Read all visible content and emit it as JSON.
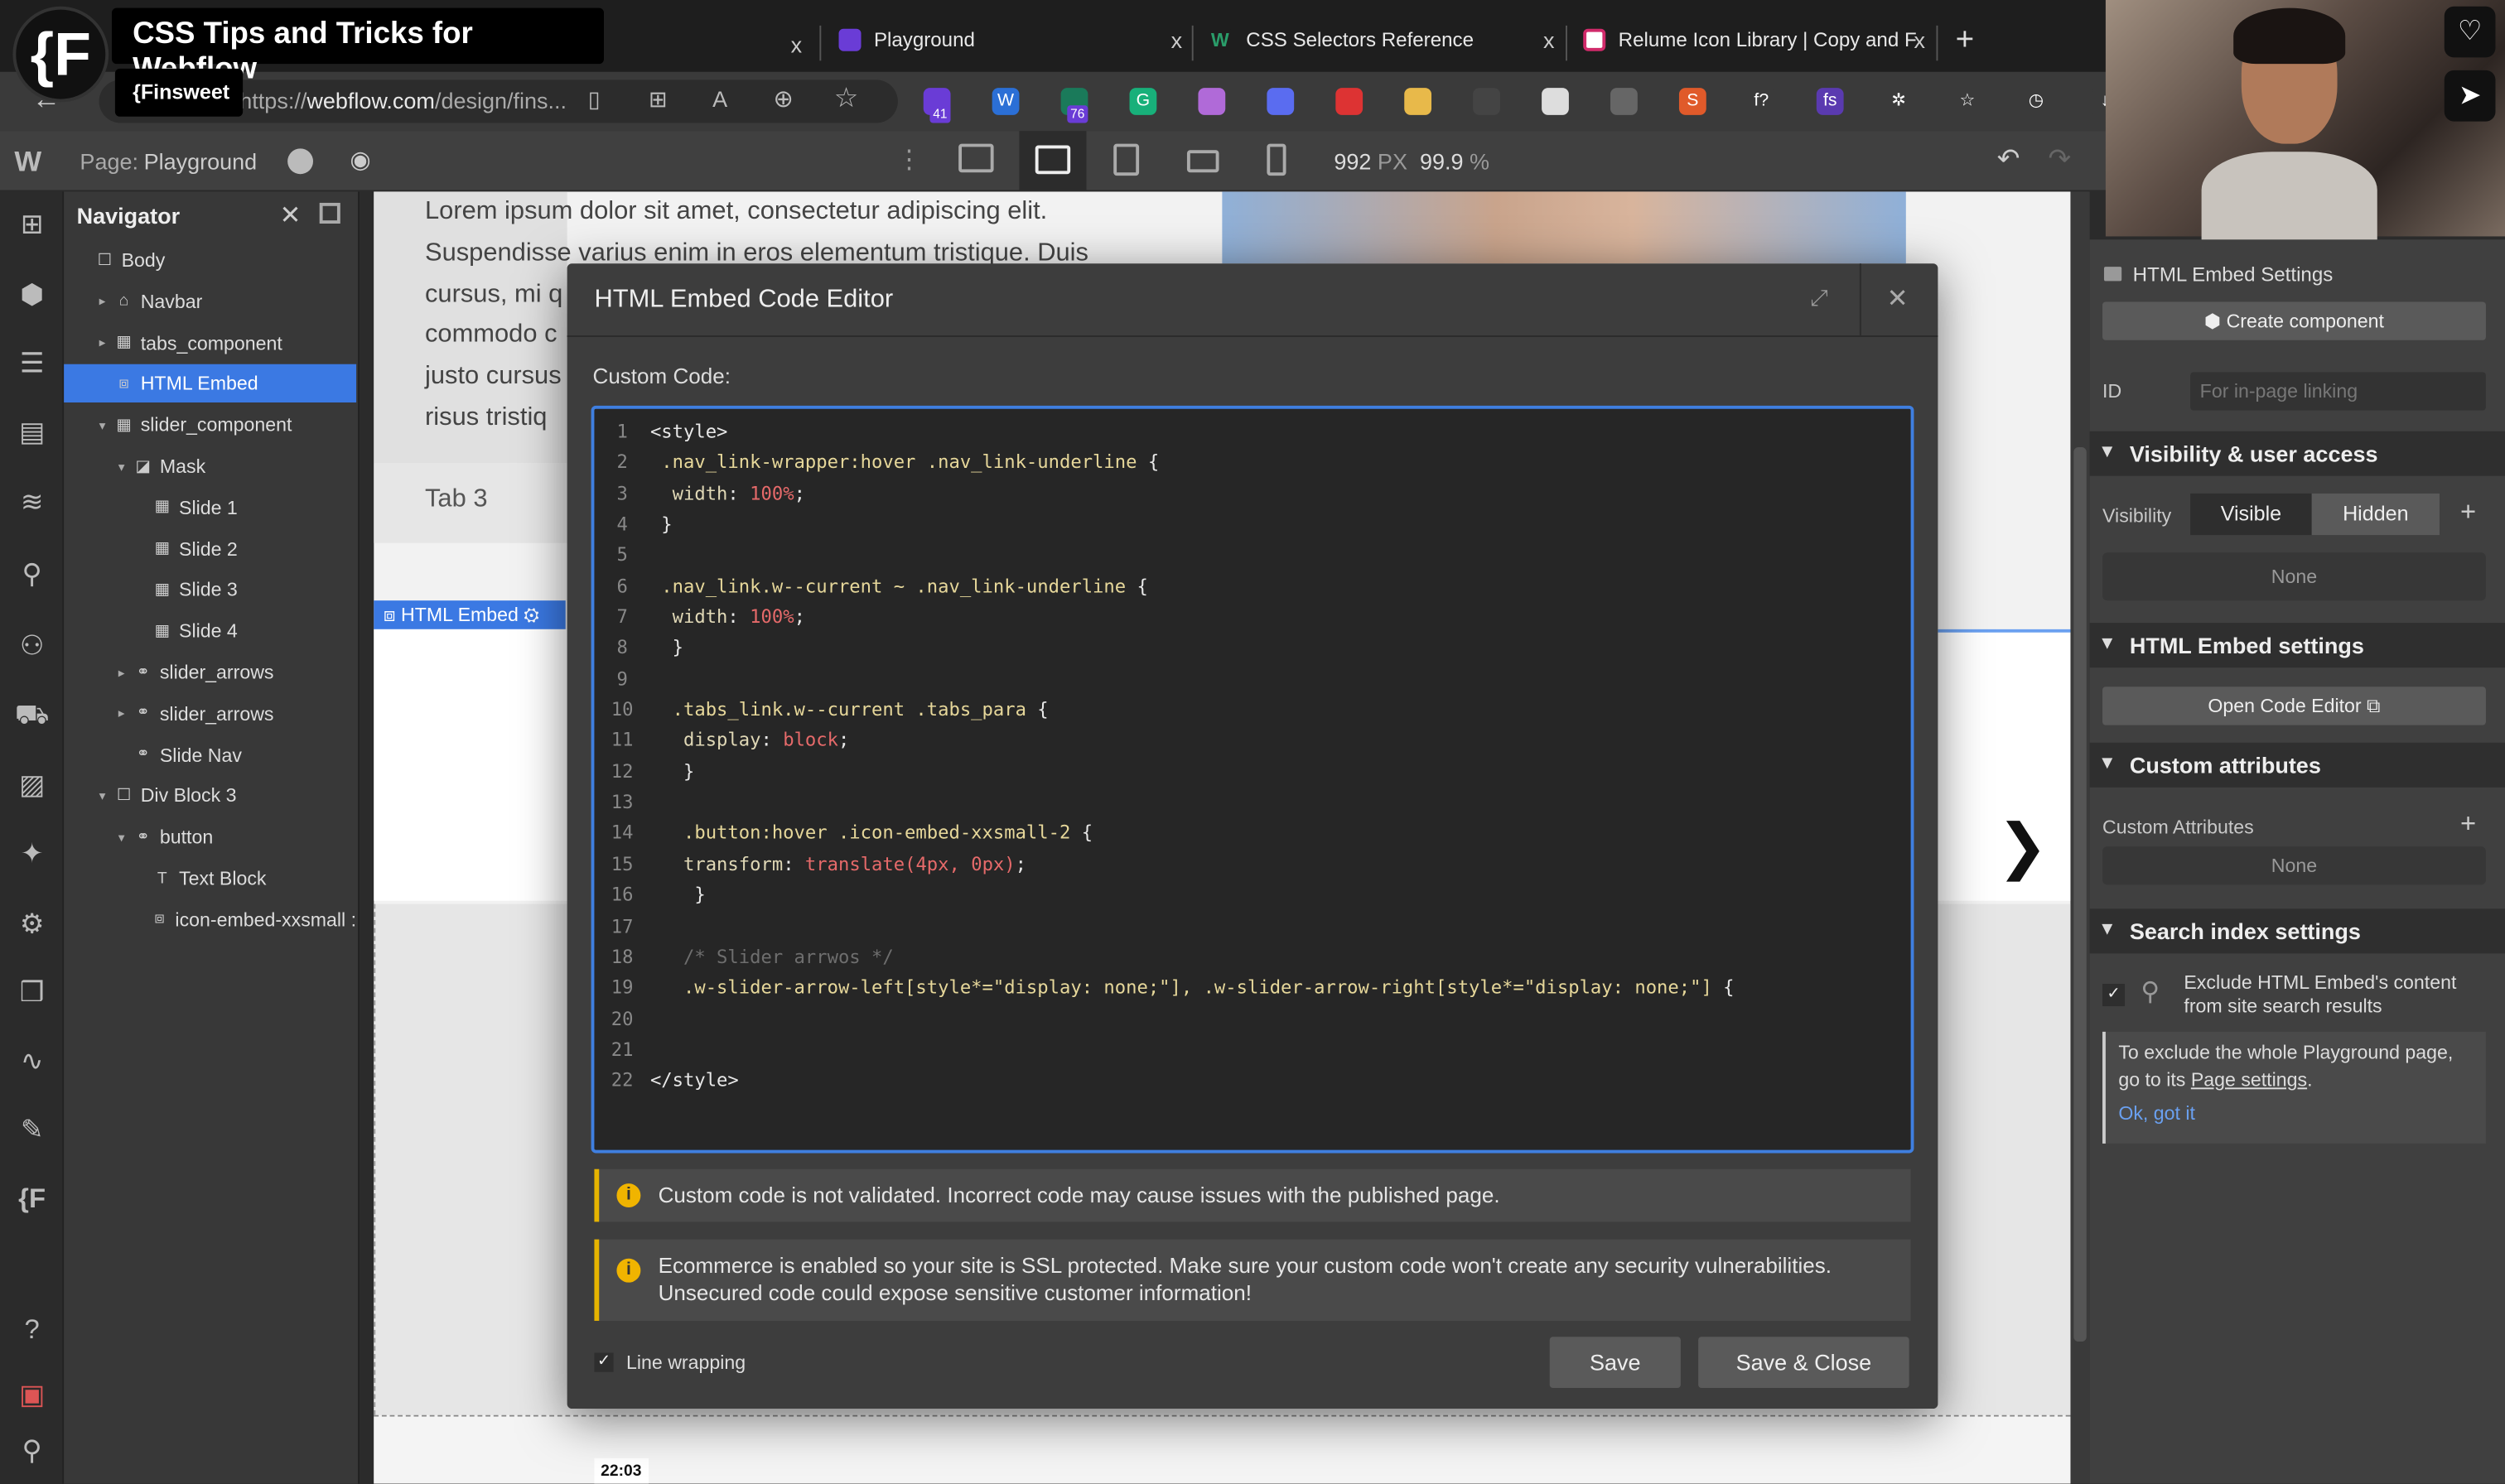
{
  "overlay": {
    "title": "CSS Tips and Tricks for Webflow",
    "subtitle": "{Finsweet",
    "logo_text": "{F"
  },
  "browser": {
    "tabs": [
      {
        "label": "Playground",
        "close": "x"
      },
      {
        "label": "CSS Selectors Reference",
        "close": "x"
      },
      {
        "label": "Relume Icon Library | Copy and F",
        "close": "x"
      }
    ],
    "first_tab_close": "x",
    "new_tab": "+",
    "url_prefix": "https://",
    "url_host": "webflow.com",
    "url_path": "/design/fins...",
    "extensions": [
      {
        "name": "ext-purple",
        "color": "#6a3cd6",
        "badge": "41"
      },
      {
        "name": "word",
        "color": "#2b6fd6",
        "text": "W"
      },
      {
        "name": "ext-green",
        "color": "#1a7a5a",
        "badge": "76"
      },
      {
        "name": "grammarly",
        "color": "#18b07a",
        "text": "G"
      },
      {
        "name": "ext-pink",
        "color": "#b06ad8"
      },
      {
        "name": "ext-blue-star",
        "color": "#5a6cf0"
      },
      {
        "name": "ext-cube",
        "color": "#d33"
      },
      {
        "name": "ext-yellow",
        "color": "#e8b94a"
      },
      {
        "name": "ext-dotted",
        "color": "#444"
      },
      {
        "name": "ext-white",
        "color": "#ddd"
      },
      {
        "name": "ext-gray",
        "color": "#666"
      },
      {
        "name": "ext-seo",
        "color": "#e05a2a",
        "text": "S"
      },
      {
        "name": "ext-f",
        "color": "#3a3a3a",
        "text": "f?"
      },
      {
        "name": "ext-fs",
        "color": "#5a3ab0",
        "text": "fs"
      },
      {
        "name": "extensions-puzzle",
        "color": "#3a3a3a",
        "text": "✲"
      },
      {
        "name": "favorites",
        "color": "#3a3a3a",
        "text": "☆"
      },
      {
        "name": "history",
        "color": "#3a3a3a",
        "text": "◷"
      },
      {
        "name": "download",
        "color": "#3a3a3a",
        "text": "↓"
      }
    ]
  },
  "webflow": {
    "page_label": "Page:",
    "page_name": "Playground",
    "width_value": "992",
    "width_unit": "PX",
    "zoom_value": "99.9",
    "zoom_unit": "%"
  },
  "navigator": {
    "title": "Navigator",
    "items": [
      {
        "label": "Body",
        "depth": 0,
        "caret": "",
        "icon": "☐"
      },
      {
        "label": "Navbar",
        "depth": 1,
        "caret": "▸",
        "icon": "⌂"
      },
      {
        "label": "tabs_component",
        "depth": 1,
        "caret": "▸",
        "icon": "▦"
      },
      {
        "label": "HTML Embed",
        "depth": 1,
        "caret": "",
        "icon": "⧈",
        "selected": true
      },
      {
        "label": "slider_component",
        "depth": 1,
        "caret": "▾",
        "icon": "▦"
      },
      {
        "label": "Mask",
        "depth": 2,
        "caret": "▾",
        "icon": "◪"
      },
      {
        "label": "Slide 1",
        "depth": 3,
        "caret": "",
        "icon": "▦"
      },
      {
        "label": "Slide 2",
        "depth": 3,
        "caret": "",
        "icon": "▦"
      },
      {
        "label": "Slide 3",
        "depth": 3,
        "caret": "",
        "icon": "▦"
      },
      {
        "label": "Slide 4",
        "depth": 3,
        "caret": "",
        "icon": "▦"
      },
      {
        "label": "slider_arrows",
        "depth": 2,
        "caret": "▸",
        "icon": "⚭"
      },
      {
        "label": "slider_arrows",
        "depth": 2,
        "caret": "▸",
        "icon": "⚭"
      },
      {
        "label": "Slide Nav",
        "depth": 2,
        "caret": "",
        "icon": "⚭"
      },
      {
        "label": "Div Block 3",
        "depth": 1,
        "caret": "▾",
        "icon": "☐"
      },
      {
        "label": "button",
        "depth": 2,
        "caret": "▾",
        "icon": "⚭"
      },
      {
        "label": "Text Block",
        "depth": 3,
        "caret": "",
        "icon": "T"
      },
      {
        "label": "icon-embed-xxsmall :",
        "depth": 3,
        "caret": "",
        "icon": "⧈"
      }
    ]
  },
  "canvas": {
    "paragraph": [
      "Lorem ipsum dolor sit amet, consectetur adipiscing elit.",
      "Suspendisse varius enim in eros elementum tristique. Duis",
      "cursus, mi q",
      "commodo c",
      "justo cursus",
      "risus tristiq"
    ],
    "tab3": "Tab 3",
    "embed_tag": "HTML Embed",
    "timestamp": "22:03"
  },
  "modal": {
    "title": "HTML Embed Code Editor",
    "custom_code_label": "Custom Code:",
    "code_lines": [
      [
        [
          "tag",
          "<style>"
        ]
      ],
      [
        [
          "sel",
          " .nav_link-wrapper:hover .nav_link-underline "
        ],
        [
          "punc",
          "{"
        ]
      ],
      [
        [
          "prop",
          "  width"
        ],
        [
          "punc",
          ": "
        ],
        [
          "val",
          "100%"
        ],
        [
          "punc",
          ";"
        ]
      ],
      [
        [
          "punc",
          " }"
        ]
      ],
      [],
      [
        [
          "sel",
          " .nav_link.w--current ~ .nav_link-underline "
        ],
        [
          "punc",
          "{"
        ]
      ],
      [
        [
          "prop",
          "  width"
        ],
        [
          "punc",
          ": "
        ],
        [
          "val",
          "100%"
        ],
        [
          "punc",
          ";"
        ]
      ],
      [
        [
          "punc",
          "  }"
        ]
      ],
      [],
      [
        [
          "sel",
          "  .tabs_link.w--current .tabs_para "
        ],
        [
          "punc",
          "{"
        ]
      ],
      [
        [
          "prop",
          "   display"
        ],
        [
          "punc",
          ": "
        ],
        [
          "val",
          "block"
        ],
        [
          "punc",
          ";"
        ]
      ],
      [
        [
          "punc",
          "   }"
        ]
      ],
      [],
      [
        [
          "sel",
          "   .button:hover .icon-embed-xxsmall-2 "
        ],
        [
          "punc",
          "{"
        ]
      ],
      [
        [
          "prop",
          "   transform"
        ],
        [
          "punc",
          ": "
        ],
        [
          "val",
          "translate(4px, 0px)"
        ],
        [
          "punc",
          ";"
        ]
      ],
      [
        [
          "punc",
          "    }"
        ]
      ],
      [],
      [
        [
          "cmt",
          "   /* Slider arrwos */"
        ]
      ],
      [
        [
          "sel",
          "   .w-slider-arrow-left[style*=\"display: none;\"], .w-slider-arrow-right[style*=\"display: none;\"] "
        ],
        [
          "punc",
          "{"
        ]
      ],
      [],
      [],
      [
        [
          "tag",
          "</style>"
        ]
      ]
    ],
    "warning1": "Custom code is not validated. Incorrect code may cause issues with the published page.",
    "warning2_line1": "Ecommerce is enabled so your site is SSL protected. Make sure your custom code won't create any security vulnerabilities.",
    "warning2_line2": "Unsecured code could expose sensitive customer information!",
    "line_wrapping": "Line wrapping",
    "save": "Save",
    "save_close": "Save & Close"
  },
  "settings": {
    "header": "HTML Embed Settings",
    "create_component": "Create component",
    "id_label": "ID",
    "id_placeholder": "For in-page linking",
    "visibility_section": "Visibility & user access",
    "visibility_label": "Visibility",
    "visible": "Visible",
    "hidden": "Hidden",
    "visibility_none": "None",
    "embed_section": "HTML Embed settings",
    "open_code_editor": "Open Code Editor",
    "attr_section": "Custom attributes",
    "attr_label": "Custom Attributes",
    "attr_none": "None",
    "search_section": "Search index settings",
    "exclude_text": "Exclude HTML Embed's content from site search results",
    "info_text": "To exclude the whole Playground page, go to its",
    "info_link": "Page settings",
    "info_end": ".",
    "ok": "Ok, got it"
  }
}
